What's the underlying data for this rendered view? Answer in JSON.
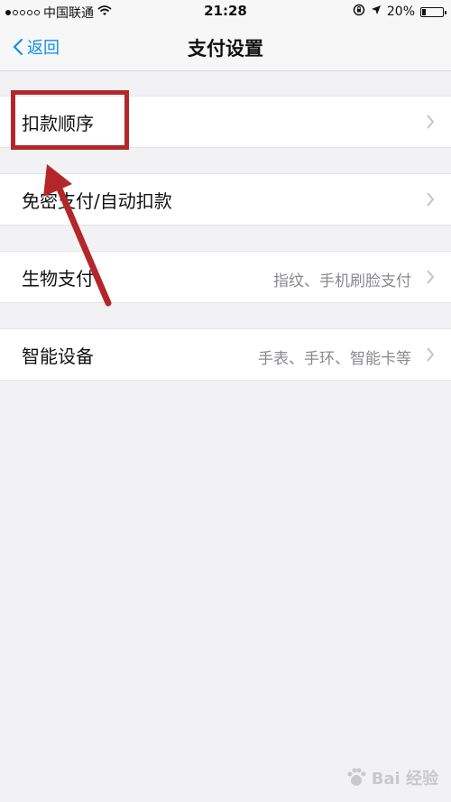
{
  "status_bar": {
    "carrier": "中国联通",
    "time": "21:28",
    "battery": "20%",
    "battery_level": 0.2,
    "signal_strength": 1
  },
  "nav": {
    "back_label": "返回",
    "title": "支付设置"
  },
  "settings": [
    {
      "label": "扣款顺序",
      "detail": ""
    },
    {
      "label": "免密支付/自动扣款",
      "detail": ""
    },
    {
      "label": "生物支付",
      "detail": "指纹、手机刷脸支付"
    },
    {
      "label": "智能设备",
      "detail": "手表、手环、智能卡等"
    }
  ],
  "watermark": {
    "text": "Bai 经验"
  },
  "colors": {
    "accent": "#108ee9",
    "annotation": "#b3272a",
    "background": "#f2f2f4"
  }
}
